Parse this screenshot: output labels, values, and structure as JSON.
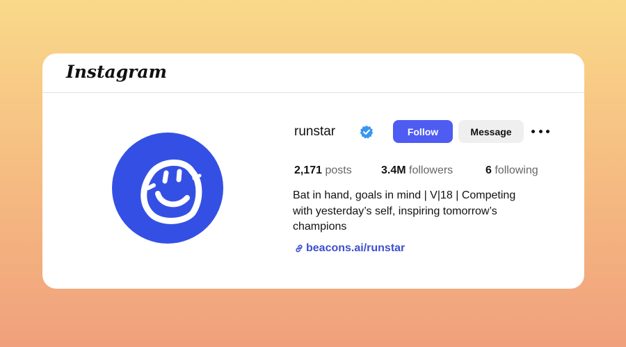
{
  "header": {
    "logo_text": "Instagram"
  },
  "profile": {
    "username": "runstar",
    "verified_icon": "verified-badge-icon",
    "follow_label": "Follow",
    "message_label": "Message",
    "more_icon": "more-options-icon",
    "stats": {
      "posts_count": "2,171",
      "posts_label": "posts",
      "followers_count": "3.4M",
      "followers_label": "followers",
      "following_count": "6",
      "following_label": "following"
    },
    "bio": "Bat in hand, goals in mind | V|18 | Competing with yesterday’s self, inspiring tomorrow’s champions",
    "link_icon": "link-icon",
    "link_text": "beacons.ai/runstar"
  },
  "colors": {
    "accent": "#4f5cf2",
    "avatar_bg": "#3450e4",
    "verified": "#3897f0",
    "link": "#3d4fd1"
  }
}
